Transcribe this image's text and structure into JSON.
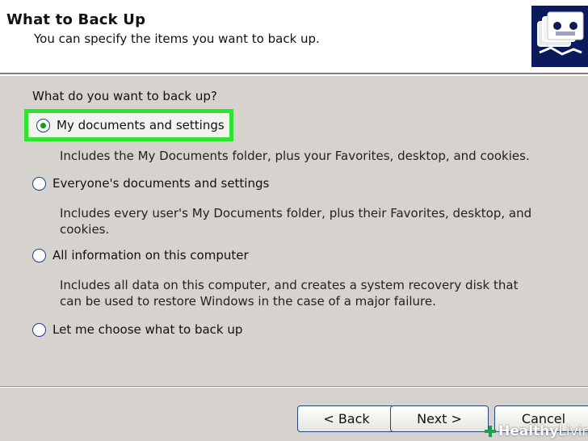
{
  "header": {
    "title": "What to Back Up",
    "subtitle": "You can specify the items you want to back up.",
    "icon": "backup-tape-icon"
  },
  "main": {
    "question": "What do you want to back up?",
    "options": [
      {
        "label": "My documents and settings",
        "selected": true,
        "description": [
          "Includes the My Documents folder, plus your Favorites, desktop, and cookies."
        ]
      },
      {
        "label": "Everyone's documents and settings",
        "selected": false,
        "description": [
          "Includes every user's My Documents folder, plus their Favorites, desktop, and",
          "cookies."
        ]
      },
      {
        "label": "All information on this computer",
        "selected": false,
        "description": [
          "Includes all data on this computer, and creates a system recovery disk that",
          "can be used to restore Windows in the case of a major failure."
        ]
      },
      {
        "label": "Let me choose what to back up",
        "selected": false,
        "description": []
      }
    ]
  },
  "footer": {
    "back_label": "< Back",
    "next_label": "Next >",
    "cancel_label": "Cancel"
  },
  "watermark": {
    "bold": "Healthy",
    "light": " Living"
  },
  "colors": {
    "highlight": "#2ee52e",
    "dialog_bg": "#d6d3ce",
    "radio_selected": "#1a9a1a"
  }
}
